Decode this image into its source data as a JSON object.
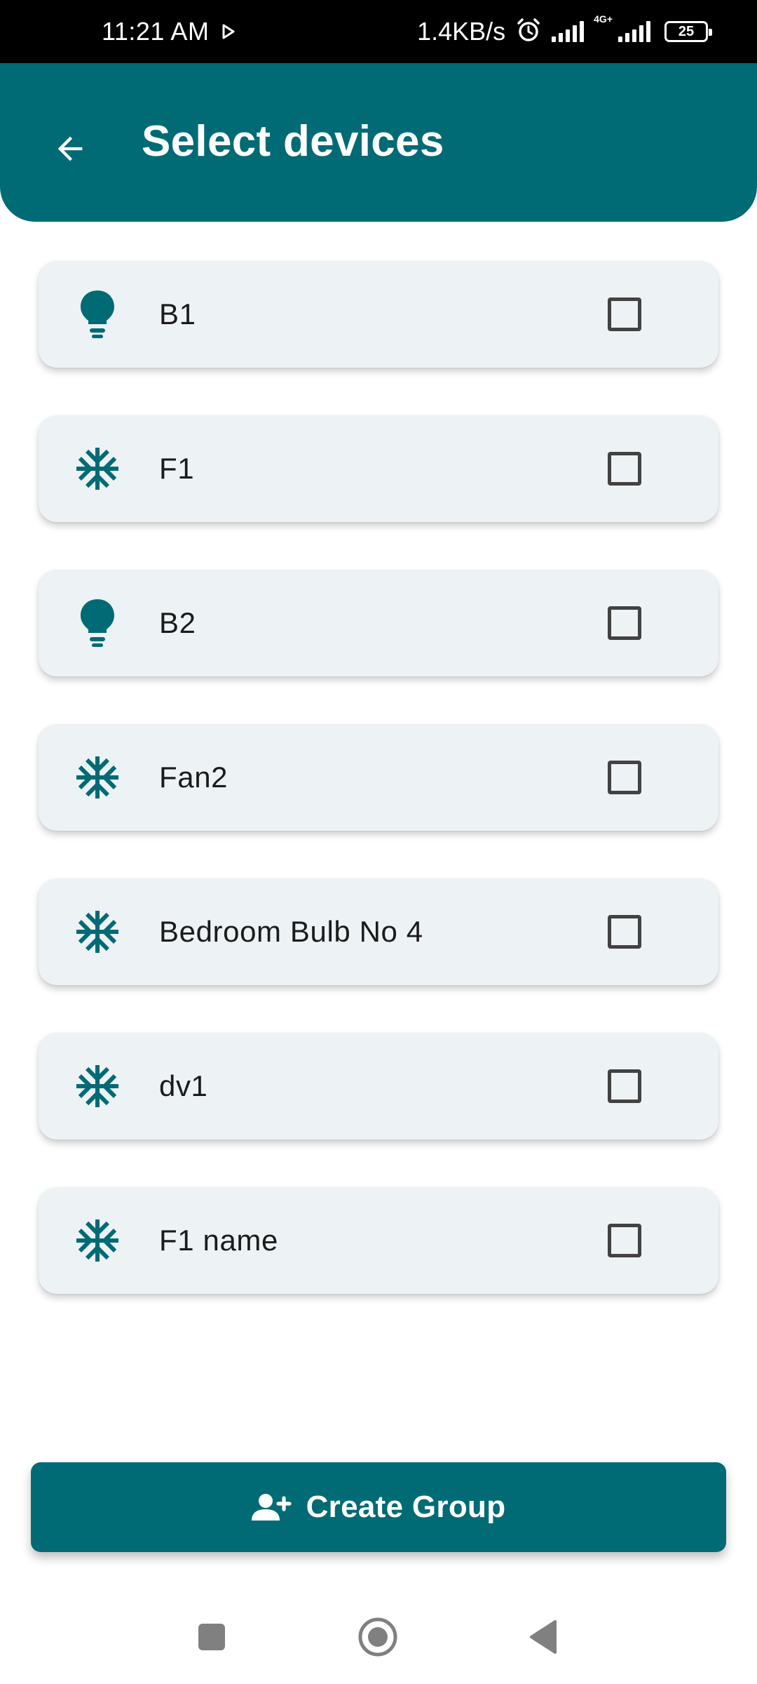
{
  "status_bar": {
    "time": "11:21 AM",
    "network_speed": "1.4KB/s",
    "network_type": "4G+",
    "battery": "25"
  },
  "app_bar": {
    "title": "Select devices",
    "back_icon": "arrow-back-icon"
  },
  "devices": [
    {
      "name": "B1",
      "icon": "lightbulb-icon",
      "checked": false
    },
    {
      "name": "F1",
      "icon": "snowflake-icon",
      "checked": false
    },
    {
      "name": "B2",
      "icon": "lightbulb-icon",
      "checked": false
    },
    {
      "name": "Fan2",
      "icon": "snowflake-icon",
      "checked": false
    },
    {
      "name": "Bedroom Bulb No 4",
      "icon": "snowflake-icon",
      "checked": false
    },
    {
      "name": "dv1",
      "icon": "snowflake-icon",
      "checked": false
    },
    {
      "name": "F1 name",
      "icon": "snowflake-icon",
      "checked": false
    }
  ],
  "create_button": {
    "label": "Create Group",
    "icon": "person-add-icon"
  },
  "nav_bar": {
    "recent": "square-icon",
    "home": "circle-icon",
    "back": "triangle-back-icon"
  },
  "colors": {
    "primary": "#016b75",
    "card_bg": "#edf2f5",
    "checkbox_border": "#424242"
  }
}
